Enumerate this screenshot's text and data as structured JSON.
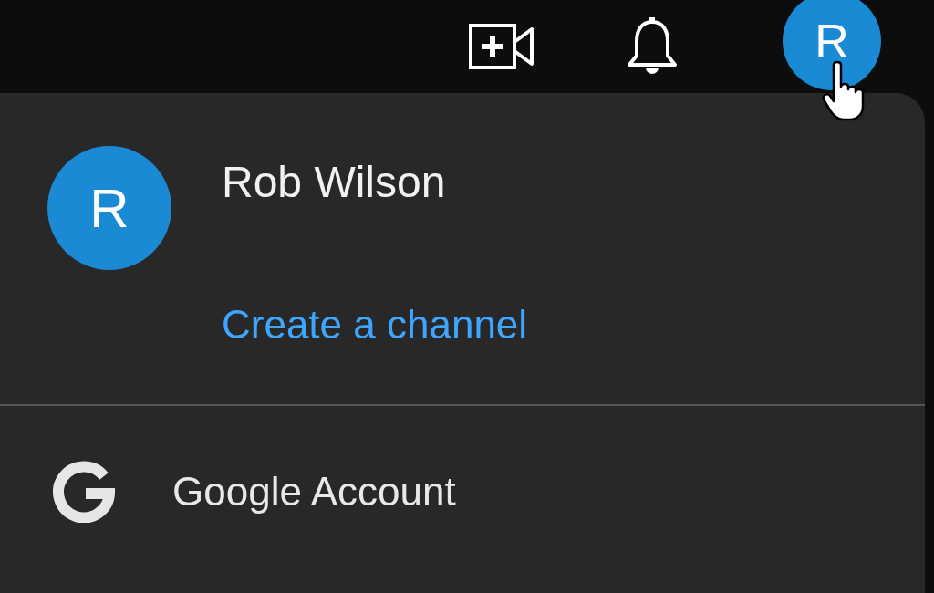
{
  "top_bar": {
    "avatar_letter": "R"
  },
  "menu": {
    "avatar_letter": "R",
    "name": "Rob Wilson",
    "link": "Create a channel",
    "items": [
      {
        "label": "Google Account"
      }
    ]
  }
}
